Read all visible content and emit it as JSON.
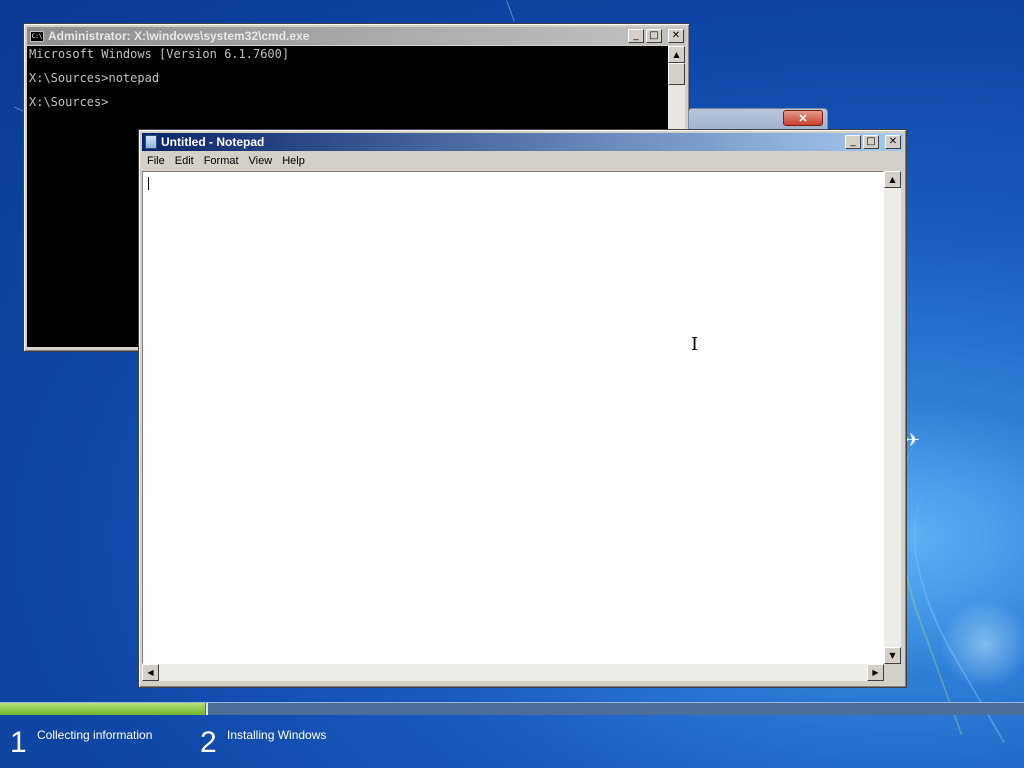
{
  "cmd": {
    "title": "Administrator: X:\\windows\\system32\\cmd.exe",
    "icon_text": "C:\\",
    "lines": [
      "Microsoft Windows [Version 6.1.7600]",
      "",
      "X:\\Sources>notepad",
      "",
      "X:\\Sources>"
    ]
  },
  "window_buttons": {
    "minimize": "_",
    "maximize": "□",
    "close": "✕"
  },
  "background_dialog": {
    "close": "✕"
  },
  "notepad": {
    "title": "Untitled - Notepad",
    "menu": [
      "File",
      "Edit",
      "Format",
      "View",
      "Help"
    ],
    "content": ""
  },
  "scroll_arrows": {
    "up": "▲",
    "down": "▼",
    "left": "◀",
    "right": "▶"
  },
  "setup": {
    "progress": 0.2,
    "steps": [
      {
        "number": "1",
        "label": "Collecting information"
      },
      {
        "number": "2",
        "label": "Installing Windows"
      }
    ]
  },
  "icons": {
    "cmd": "command-prompt-icon",
    "notepad": "notepad-icon",
    "cursor": "text-cursor-icon"
  }
}
